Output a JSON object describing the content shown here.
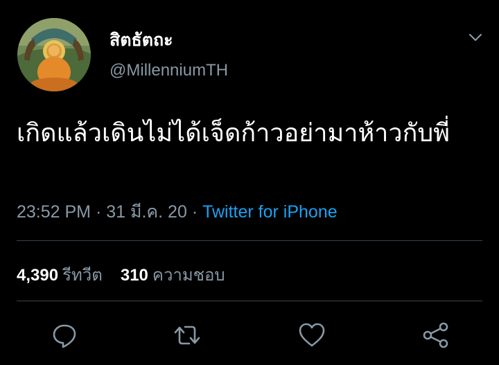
{
  "author": {
    "display_name": "สิตธัตถะ",
    "handle": "@MillenniumTH",
    "avatar_icon": "buddha-avatar",
    "menu_icon": "chevron-down-icon"
  },
  "tweet": {
    "text": "เกิดแล้วเดินไม่ได้เจ็ดก้าวอย่ามาห้าวกับพี่"
  },
  "meta": {
    "time": "23:52 PM",
    "separator": "·",
    "date": "31 มี.ค. 20",
    "source": "Twitter for iPhone"
  },
  "stats": {
    "retweets_count": "4,390",
    "retweets_label": "รีทวีต",
    "likes_count": "310",
    "likes_label": "ความชอบ"
  },
  "actions": [
    "reply-icon",
    "retweet-icon",
    "like-icon",
    "share-icon"
  ],
  "colors": {
    "background": "#000000",
    "text": "#ffffff",
    "secondary": "#8899a6",
    "link": "#1da1f2",
    "divider": "#38444d"
  }
}
